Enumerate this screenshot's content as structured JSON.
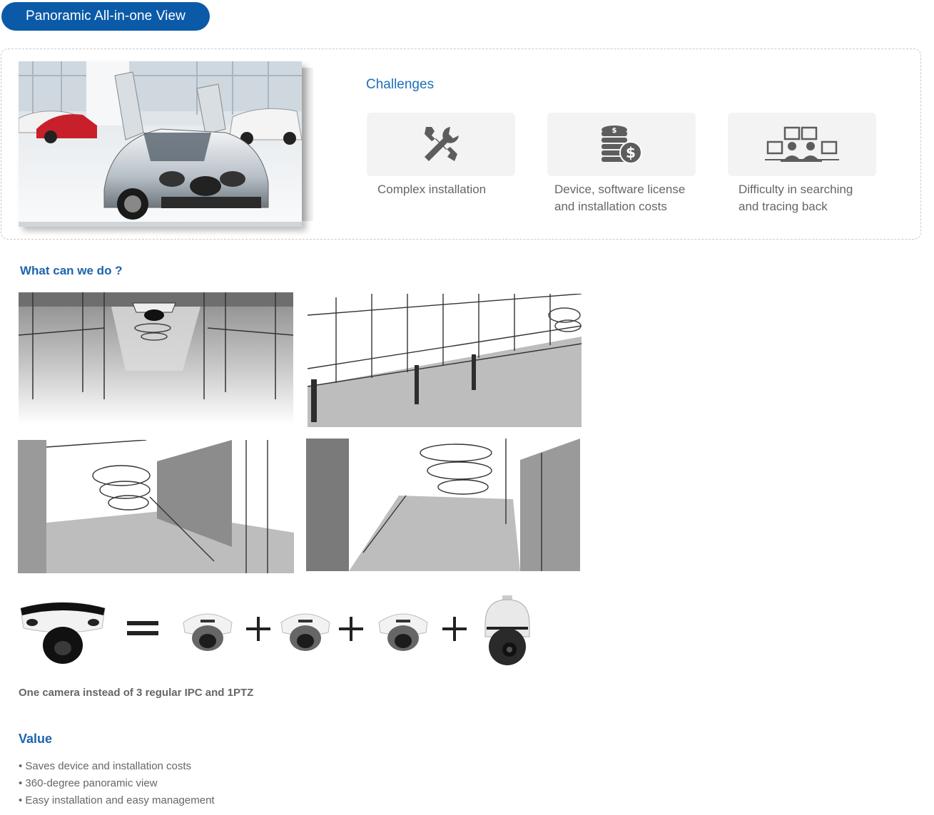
{
  "header": {
    "title": "Panoramic All-in-one View"
  },
  "challenges": {
    "title": "Challenges",
    "items": [
      {
        "icon": "tools-icon",
        "label_line1": "Complex installation",
        "label_line2": ""
      },
      {
        "icon": "coins-icon",
        "label_line1": "Device, software license",
        "label_line2": "and installation costs"
      },
      {
        "icon": "monitors-icon",
        "label_line1": "Difficulty in searching",
        "label_line2": "and tracing back"
      }
    ]
  },
  "what": {
    "title": "What can we do ?"
  },
  "equation": {
    "equals": "=",
    "plus": "+",
    "caption": "One camera instead of 3 regular IPC and 1PTZ"
  },
  "value": {
    "title": "Value",
    "items": [
      "• Saves device and installation costs",
      "• 360-degree panoramic view",
      "• Easy installation and easy management"
    ]
  },
  "colors": {
    "accent": "#0b5aa8",
    "heading": "#1d64ad",
    "card_bg": "#f3f3f3"
  }
}
